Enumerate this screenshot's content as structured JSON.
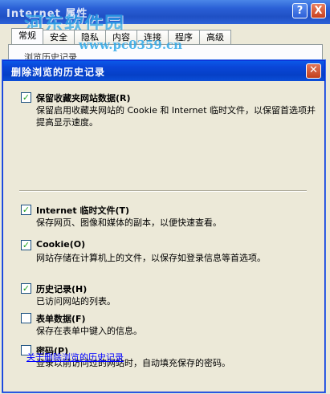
{
  "parent_window": {
    "title": "Internet 属性",
    "help_glyph": "?",
    "close_glyph": "X",
    "tabs": [
      "常规",
      "安全",
      "隐私",
      "内容",
      "连接",
      "程序",
      "高级"
    ],
    "partial_text": "浏览历史记录"
  },
  "watermark": {
    "site_name": "河东软件园",
    "url": "www.pc0359.cn"
  },
  "dialog": {
    "title": "删除浏览的历史记录",
    "close_glyph": "✕",
    "items": [
      {
        "label": "保留收藏夹网站数据(R)",
        "checked": true,
        "description": "保留启用收藏夹网站的 Cookie 和 Internet 临时文件，以保留首选项并提高显示速度。"
      },
      {
        "label": "Internet 临时文件(T)",
        "checked": true,
        "description": "保存网页、图像和媒体的副本，以便快速查看。"
      },
      {
        "label": "Cookie(O)",
        "checked": true,
        "description": "网站存储在计算机上的文件，以保存如登录信息等首选项。"
      },
      {
        "label": "历史记录(H)",
        "checked": true,
        "description": "已访问网站的列表。"
      },
      {
        "label": "表单数据(F)",
        "checked": false,
        "description": "保存在表单中键入的信息。"
      },
      {
        "label": "密码(P)",
        "checked": false,
        "description": "登录以前访问过的网站时，自动填充保存的密码。"
      }
    ],
    "about_link": "关于删除浏览的历史记录"
  },
  "colors": {
    "titlebar_blue": "#0a46d8",
    "dialog_bg": "#ece9d8",
    "close_red": "#c8401e",
    "link_blue": "#0000ff",
    "check_green": "#21a121"
  }
}
